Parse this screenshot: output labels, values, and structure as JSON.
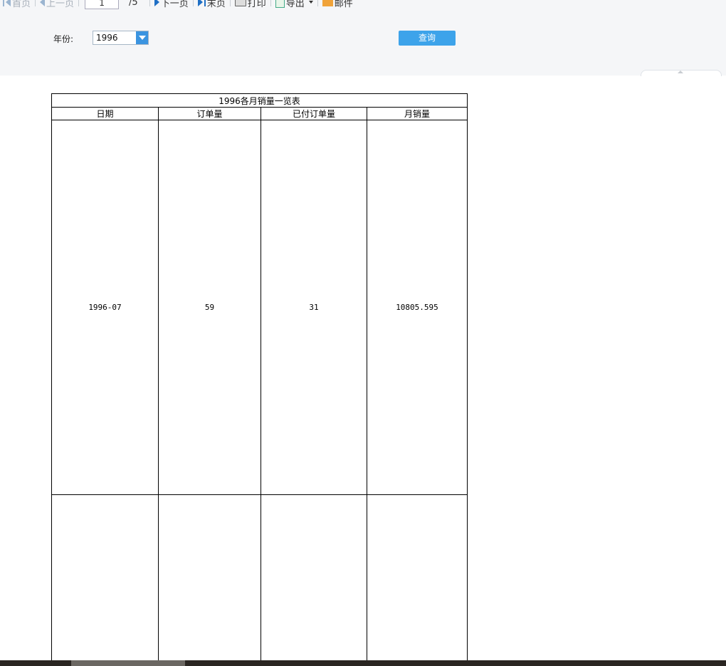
{
  "toolbar": {
    "first_label": "首页",
    "prev_label": "上一页",
    "current_page": "1",
    "total_pages": "/5",
    "next_label": "下一页",
    "last_label": "末页",
    "print_label": "打印",
    "export_label": "导出",
    "mail_label": "邮件"
  },
  "params": {
    "year_label": "年份:",
    "year_value": "1996",
    "query_label": "查询"
  },
  "report": {
    "title": "1996各月销量一览表",
    "columns": [
      "日期",
      "订单量",
      "已付订单量",
      "月销量"
    ],
    "rows": [
      [
        "1996-07",
        "59",
        "31",
        "10805.595"
      ],
      [
        "",
        "",
        "",
        ""
      ]
    ]
  },
  "colors": {
    "accent": "#3da3ea",
    "panel_bg": "#f5f6f8",
    "status_bar": "#2a2622"
  }
}
